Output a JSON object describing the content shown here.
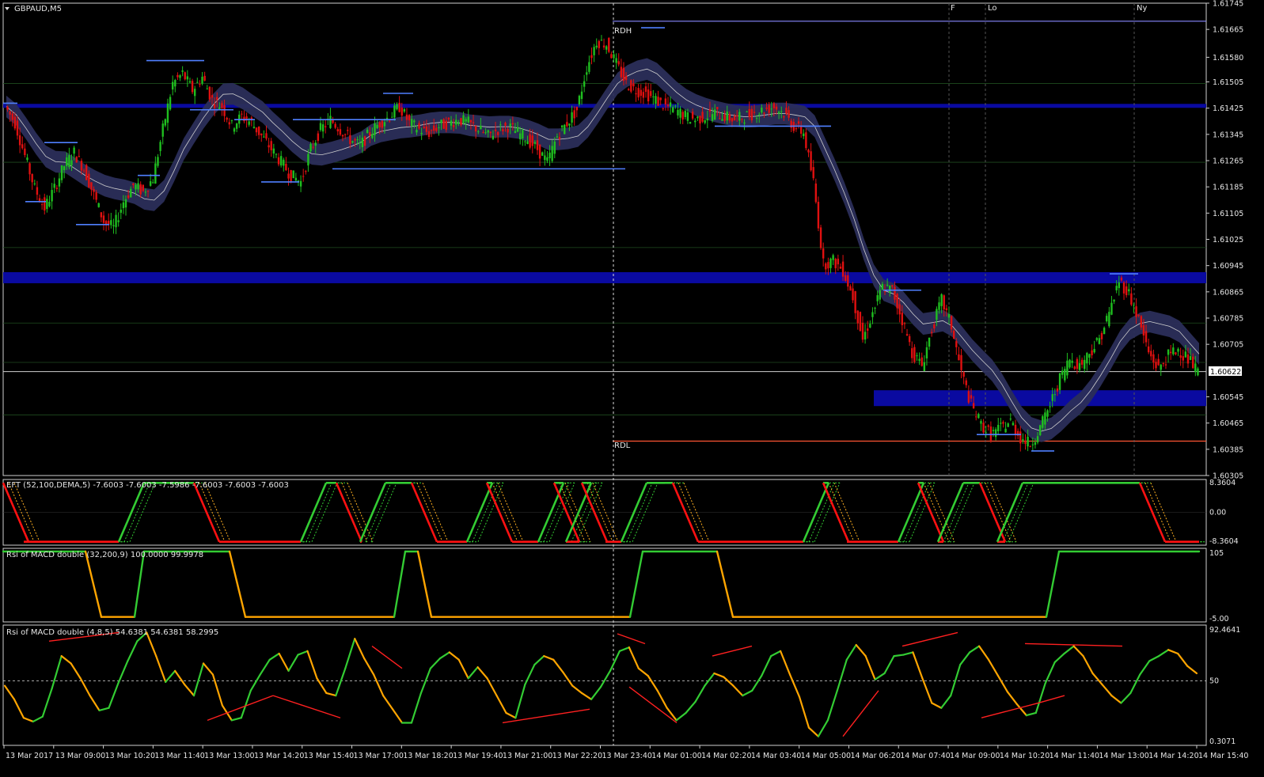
{
  "window": {
    "title": "GBPAUD,M5"
  },
  "colors": {
    "bull": "#1fbf1f",
    "bear": "#e01010",
    "ma_band": "#2b2e5a",
    "ma_line": "#cfcfcf",
    "level": "#0a0aa0",
    "rd_high": "#8888ff",
    "rd_low": "#ff5533",
    "ind_up": "#33cc33",
    "ind_down": "#ff1111",
    "rsi_up": "#33cc33",
    "rsi_down": "#ffa500",
    "div_line": "#ff2020",
    "grid": "#2a4a2a"
  },
  "session_labels": [
    "F",
    "Lo",
    "Ny"
  ],
  "range_labels": {
    "high": "RDH",
    "low": "RDL"
  },
  "current_price": "1.60622",
  "x_labels": [
    "13 Mar 2017",
    "13 Mar 09:00",
    "13 Mar 10:20",
    "13 Mar 11:40",
    "13 Mar 13:00",
    "13 Mar 14:20",
    "13 Mar 15:40",
    "13 Mar 17:00",
    "13 Mar 18:20",
    "13 Mar 19:40",
    "13 Mar 21:00",
    "13 Mar 22:20",
    "13 Mar 23:40",
    "14 Mar 01:00",
    "14 Mar 02:20",
    "14 Mar 03:40",
    "14 Mar 05:00",
    "14 Mar 06:20",
    "14 Mar 07:40",
    "14 Mar 09:00",
    "14 Mar 10:20",
    "14 Mar 11:40",
    "14 Mar 13:00",
    "14 Mar 14:20",
    "14 Mar 15:40"
  ],
  "chart_data": [
    {
      "type": "line",
      "title": "GBPAUD,M5",
      "ylim": [
        1.60305,
        1.61745
      ],
      "y_ticks": [
        "1.61745",
        "1.61665",
        "1.61580",
        "1.61505",
        "1.61425",
        "1.61345",
        "1.61265",
        "1.61185",
        "1.61105",
        "1.61025",
        "1.60945",
        "1.60865",
        "1.60785",
        "1.60705",
        "1.60545",
        "1.60465",
        "1.60385",
        "1.60305"
      ],
      "resistance_high": 1.6169,
      "support_low": 1.6041,
      "close_series": [
        1.6143,
        1.6138,
        1.6128,
        1.6118,
        1.6112,
        1.6118,
        1.6125,
        1.6129,
        1.6124,
        1.6116,
        1.6108,
        1.6106,
        1.6114,
        1.6119,
        1.6117,
        1.6121,
        1.6136,
        1.615,
        1.6153,
        1.6148,
        1.6152,
        1.6145,
        1.6143,
        1.6137,
        1.614,
        1.6138,
        1.6134,
        1.613,
        1.6126,
        1.6122,
        1.612,
        1.613,
        1.6136,
        1.6139,
        1.6136,
        1.6133,
        1.6131,
        1.6135,
        1.6138,
        1.614,
        1.6143,
        1.6138,
        1.6136,
        1.6135,
        1.6137,
        1.6138,
        1.6139,
        1.6138,
        1.6136,
        1.6134,
        1.6136,
        1.6137,
        1.6135,
        1.6133,
        1.613,
        1.6126,
        1.6134,
        1.6138,
        1.6142,
        1.6155,
        1.6163,
        1.6162,
        1.6156,
        1.615,
        1.6148,
        1.6147,
        1.6145,
        1.6143,
        1.6142,
        1.614,
        1.6139,
        1.614,
        1.6141,
        1.614,
        1.6139,
        1.614,
        1.6141,
        1.6142,
        1.6143,
        1.6141,
        1.6137,
        1.6135,
        1.612,
        1.6095,
        1.6096,
        1.6093,
        1.6085,
        1.6072,
        1.608,
        1.6088,
        1.6087,
        1.6078,
        1.6068,
        1.6064,
        1.6075,
        1.6084,
        1.6076,
        1.6062,
        1.6052,
        1.6046,
        1.6043,
        1.6045,
        1.6047,
        1.6042,
        1.604,
        1.6045,
        1.6052,
        1.606,
        1.6066,
        1.6064,
        1.6068,
        1.6072,
        1.608,
        1.609,
        1.6086,
        1.6078,
        1.6068,
        1.6063,
        1.6067,
        1.6069,
        1.6066,
        1.6062
      ]
    },
    {
      "type": "line",
      "title": "EFT (52,100,DEMA,5)  -7.6003 -7.6003 -7.5986 -7.6003 -7.6003 -7.6003",
      "ylim": [
        -8.3604,
        8.3604
      ],
      "y_ticks": [
        "8.3604",
        "0.00",
        "-8.3604"
      ]
    },
    {
      "type": "line",
      "title": "Rsi of MACD double (32,200,9) 100.0000 99.9978",
      "ylim": [
        -5,
        105
      ],
      "y_ticks": [
        "105",
        "-5.00"
      ]
    },
    {
      "type": "line",
      "title": "Rsi of MACD double (4,8,5) 54.6381 54.6381 58.2995",
      "ylim": [
        0.3071,
        92.4641
      ],
      "y_ticks": [
        "92.4641",
        "50",
        "0.3071"
      ],
      "series_values": [
        46,
        35,
        20,
        17,
        21,
        44,
        70,
        64,
        52,
        38,
        26,
        28,
        48,
        66,
        82,
        89,
        70,
        49,
        58,
        47,
        38,
        64,
        55,
        30,
        18,
        20,
        42,
        55,
        67,
        72,
        58,
        71,
        74,
        52,
        40,
        38,
        60,
        84,
        68,
        55,
        38,
        27,
        16,
        16,
        40,
        60,
        68,
        73,
        67,
        52,
        61,
        52,
        38,
        24,
        20,
        47,
        63,
        70,
        67,
        57,
        46,
        40,
        35,
        45,
        58,
        74,
        77,
        60,
        54,
        42,
        28,
        18,
        24,
        33,
        46,
        56,
        53,
        46,
        38,
        42,
        54,
        70,
        74,
        55,
        37,
        12,
        5,
        18,
        42,
        67,
        79,
        70,
        51,
        56,
        70,
        71,
        73,
        52,
        32,
        28,
        38,
        63,
        73,
        78,
        67,
        54,
        41,
        31,
        22,
        24,
        48,
        65,
        72,
        78,
        70,
        56,
        47,
        38,
        32,
        40,
        55,
        66,
        70,
        75,
        72,
        62,
        56
      ]
    }
  ]
}
